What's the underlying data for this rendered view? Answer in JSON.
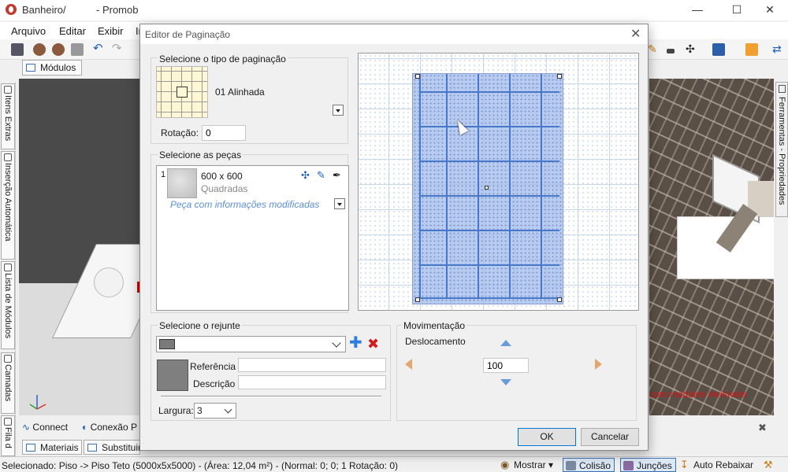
{
  "window": {
    "title_file": "Banheiro/",
    "title_app": "- Promob"
  },
  "menu": [
    "Arquivo",
    "Editar",
    "Exibir",
    "In"
  ],
  "modules_tab": "Módulos",
  "left_tabs": [
    "Itens Extras",
    "Inserção Automática",
    "Lista de Módulos",
    "Camadas",
    "Fila d"
  ],
  "right_tab": "Ferramentas - Propriedades",
  "viewport": {
    "note": "com módulos invisíveis"
  },
  "connect": {
    "connect_label": "Connect",
    "conexao_label": "Conexão P"
  },
  "bottom_tabs": [
    "Materiais",
    "Substituir"
  ],
  "status": {
    "text": "Selecionado: Piso -> Piso Teto (5000x5x5000) - (Área: 12,04 m²) - (Normal: 0; 0; 1 Rotação: 0)",
    "mostrar": "Mostrar",
    "colisao": "Colisão",
    "juncoes": "Junções",
    "auto_rebaixar": "Auto Rebaixar"
  },
  "dialog": {
    "title": "Editor de Paginação",
    "pagination_group": "Selecione o tipo de paginação",
    "pagination_type": "01 Alinhada",
    "rotation_label": "Rotação:",
    "rotation_value": "0",
    "pieces_group": "Selecione as peças",
    "piece": {
      "index": "1",
      "size": "600 x 600",
      "type": "Quadradas",
      "note": "Peça com informações modificadas"
    },
    "grout_group": "Selecione o rejunte",
    "reference_label": "Referência",
    "reference_value": "",
    "description_label": "Descrição",
    "description_value": "",
    "width_label": "Largura:",
    "width_value": "3",
    "movement_group": "Movimentação",
    "displacement_label": "Deslocamento",
    "displacement_value": "100",
    "ok_label": "OK",
    "cancel_label": "Cancelar"
  },
  "colors": {
    "accent": "#0078d7",
    "grout": "#7f7f7f",
    "preview_floor": "#a0b9eb",
    "note_red": "#e01010"
  }
}
